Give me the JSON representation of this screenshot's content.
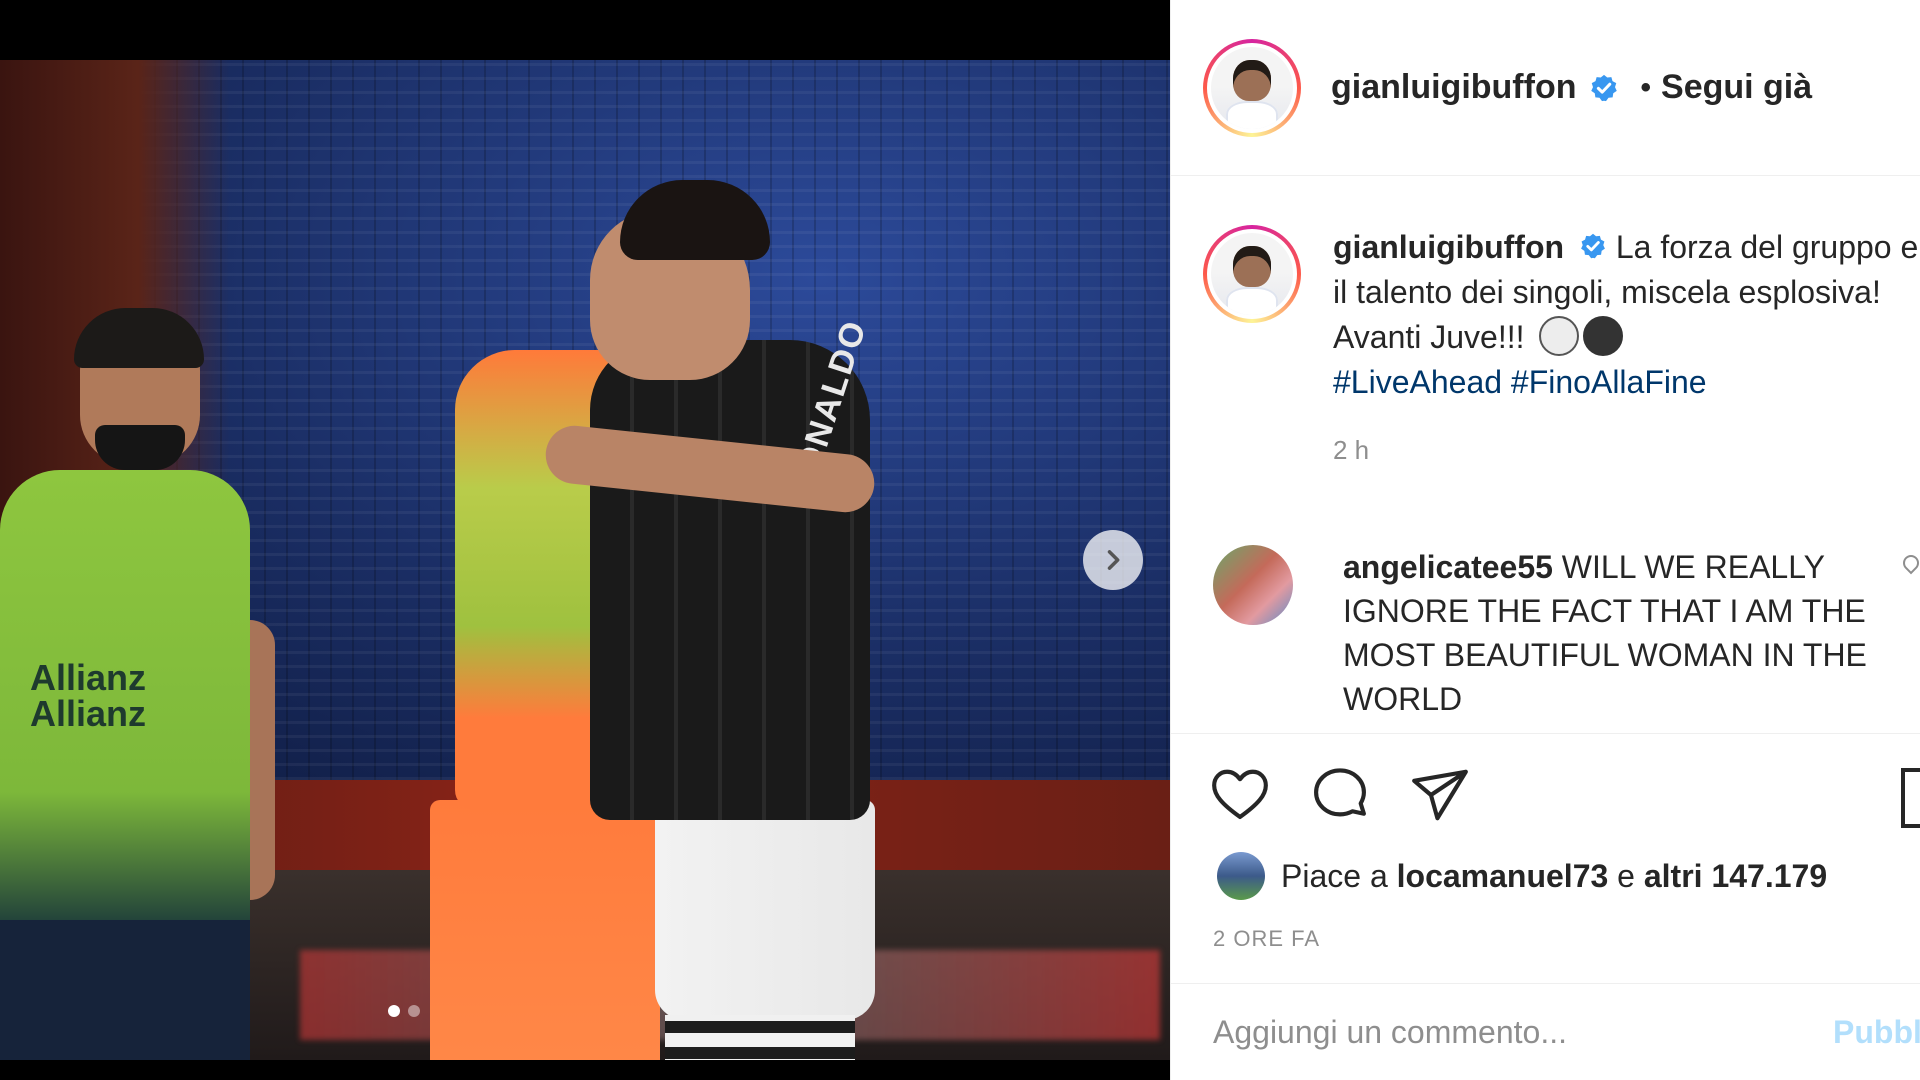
{
  "header": {
    "username": "gianluigibuffon",
    "separator": "•",
    "follow_label": "Segui già"
  },
  "media": {
    "jersey_name": "RONALDO",
    "sponsor_line1": "Allianz",
    "sponsor_line2": "Allianz",
    "carousel_dots": 2,
    "active_dot": 0
  },
  "caption": {
    "username": "gianluigibuffon",
    "text": "La forza del gruppo e il talento dei singoli, miscela esplosiva! Avanti Juve!!!",
    "hashtag1": "#LiveAhead",
    "hashtag2": "#FinoAllaFine",
    "time": "2 h"
  },
  "comment": {
    "username": "angelicatee55",
    "text": "WILL WE REALLY IGNORE THE FACT THAT I AM THE MOST BEAUTIFUL WOMAN IN THE WORLD"
  },
  "likes": {
    "prefix": "Piace a",
    "user": "locamanuel73",
    "conj": "e",
    "others": "altri 147.179"
  },
  "post_time": "2 ORE FA",
  "add_comment": {
    "placeholder": "Aggiungi un commento...",
    "publish_label": "Pubblica"
  },
  "colors": {
    "verified": "#3897f0",
    "hashtag": "#00376b",
    "muted": "#8e8e8e",
    "publish": "#b2dffc"
  }
}
